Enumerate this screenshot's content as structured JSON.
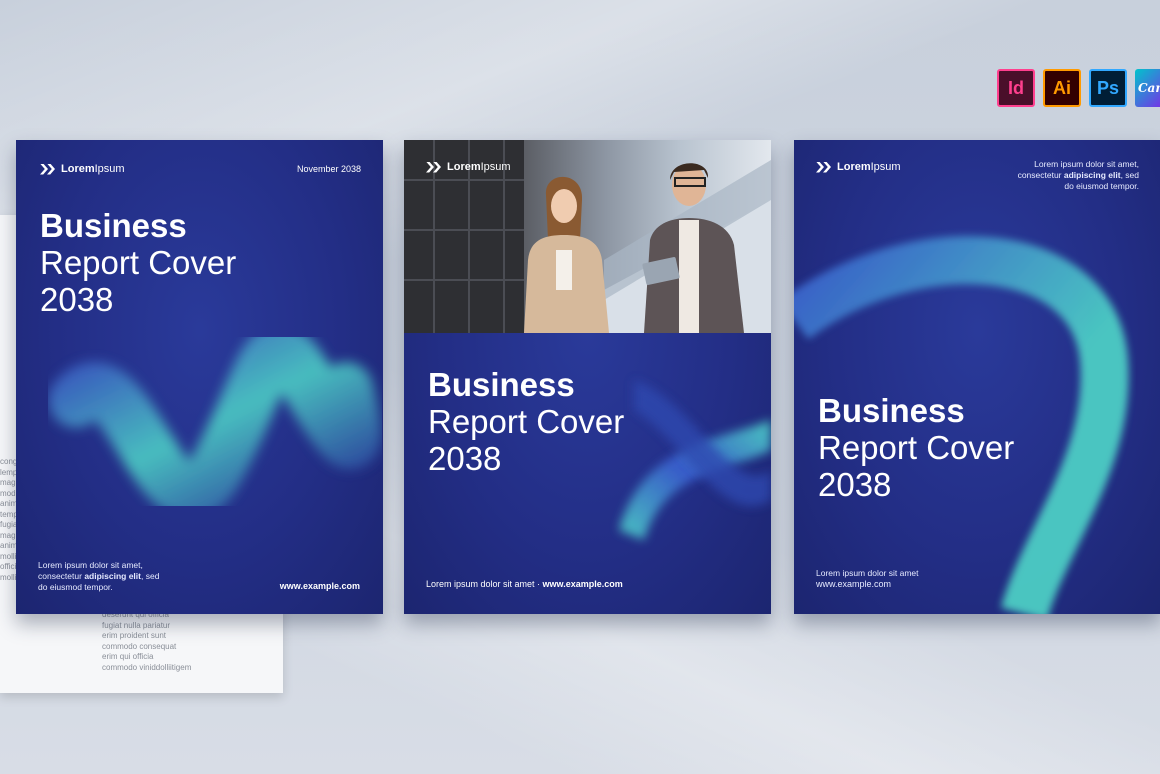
{
  "badges": [
    {
      "label": "Id",
      "name": "indesign-badge"
    },
    {
      "label": "Ai",
      "name": "illustrator-badge"
    },
    {
      "label": "Ps",
      "name": "photoshop-badge"
    },
    {
      "label": "Canva",
      "name": "canva-badge"
    }
  ],
  "colors": {
    "cover_bg": "#232e86",
    "ribbon_teal": "#4fd6c8",
    "ribbon_blue": "#3a5fd0"
  },
  "cover1": {
    "logo_bold": "Lorem",
    "logo_light": "Ipsum",
    "date": "November 2038",
    "title_bold": "Business",
    "title_line2": "Report Cover",
    "title_line3": "2038",
    "body_line1": "Lorem ipsum dolor sit amet,",
    "body_line2_a": "consectetur ",
    "body_line2_b": "adipiscing elit",
    "body_line2_c": ", sed",
    "body_line3": "do eiusmod tempor.",
    "url": "www.example.com"
  },
  "cover2": {
    "logo_bold": "Lorem",
    "logo_light": "Ipsum",
    "title_bold": "Business",
    "title_line2": "Report Cover",
    "title_line3": "2038",
    "footer_text": "Lorem ipsum dolor sit amet · ",
    "url": "www.example.com"
  },
  "cover3": {
    "logo_bold": "Lorem",
    "logo_light": "Ipsum",
    "top_line1": "Lorem ipsum dolor sit amet,",
    "top_line2_a": "consectetur ",
    "top_line2_b": "adipiscing elit",
    "top_line2_c": ", sed",
    "top_line3": "do eiusmod tempor.",
    "title_bold": "Business",
    "title_line2": "Report Cover",
    "title_line3": "2038",
    "body_line1": "Lorem ipsum dolor sit amet",
    "url": "www.example.com"
  },
  "paper_text": {
    "col1": "cong\nlemp\nmag\nmod\nanim\ntemp\nfugia\nmag\nanim\nmollit anim id est\nofficia deserunt\nmollit anim id est",
    "col2": "deserunt qui officia\nfugiat nulla pariatur\nerim proident sunt\ncommodo consequat\nerim qui officia\ncommodo viniddolliitigem"
  }
}
